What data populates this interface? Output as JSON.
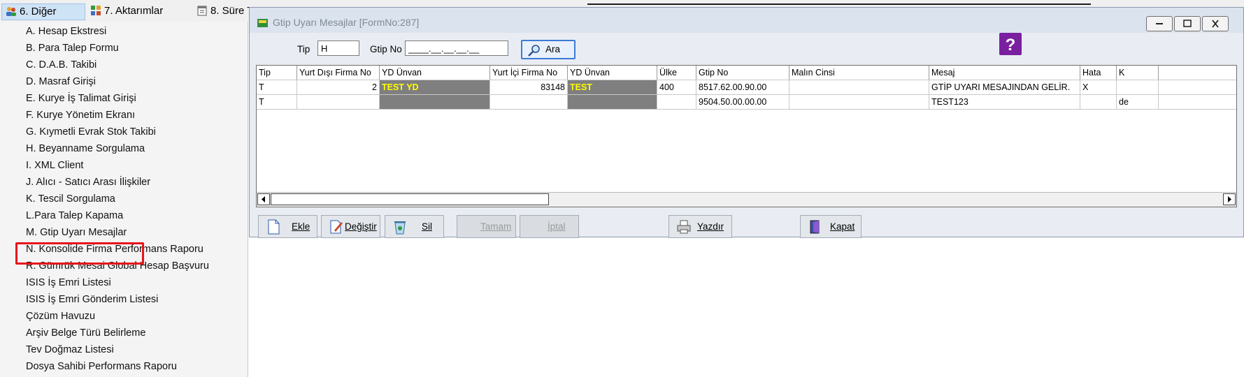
{
  "menubar": {
    "tabs": [
      {
        "label": "6.  Diğer"
      },
      {
        "label": "7.  Aktarımlar"
      },
      {
        "label": "8. Süre T"
      }
    ]
  },
  "menu": {
    "items": [
      "A.  Hesap Ekstresi",
      "B.  Para Talep Formu",
      "C.  D.A.B. Takibi",
      "D.  Masraf Girişi",
      "E.  Kurye İş Talimat Girişi",
      "F.  Kurye Yönetim Ekranı",
      "G.  Kıymetli Evrak Stok Takibi",
      "H.  Beyanname Sorgulama",
      "I.   XML Client",
      "J.  Alıcı - Satıcı Arası İlişkiler",
      "K.  Tescil Sorgulama",
      "L.Para Talep Kapama",
      "M. Gtip Uyarı Mesajlar",
      "N. Konsolide Firma Performans Raporu",
      "R. Gümrük Mesai Global Hesap Başvuru",
      "ISIS İş Emri Listesi",
      "ISIS İş Emri Gönderim Listesi",
      "Çözüm Havuzu",
      "Arşiv Belge Türü Belirleme",
      "Tev Doğmaz Listesi",
      "Dosya Sahibi Performans Raporu"
    ]
  },
  "window": {
    "title": "Gtip Uyarı Mesajlar [FormNo:287]"
  },
  "filters": {
    "tip_label": "Tip",
    "tip_value": "H",
    "gtip_label": "Gtip No",
    "gtip_value": "____.__.__.__.__",
    "search_label": "Ara"
  },
  "grid": {
    "columns": [
      "Tip",
      "Yurt Dışı Firma No",
      "YD Ünvan",
      "Yurt İçi Firma No",
      "YD Ünvan",
      "Ülke",
      "Gtip No",
      "Malın Cinsi",
      "Mesaj",
      "Hata",
      "K"
    ],
    "rows": [
      [
        "T",
        "2",
        "TEST YD",
        "83148",
        "TEST",
        "400",
        "8517.62.00.90.00",
        "",
        "GTİP UYARI MESAJINDAN GELİR.",
        "X",
        ""
      ],
      [
        "T",
        "",
        "",
        "",
        "",
        "",
        "9504.50.00.00.00",
        "",
        "TEST123",
        "",
        "de"
      ]
    ]
  },
  "toolbar": {
    "add": "Ekle",
    "edit": "Değiştir",
    "delete": "Sil",
    "ok": "Tamam",
    "cancel": "İptal",
    "print": "Yazdır",
    "close": "Kapat"
  }
}
